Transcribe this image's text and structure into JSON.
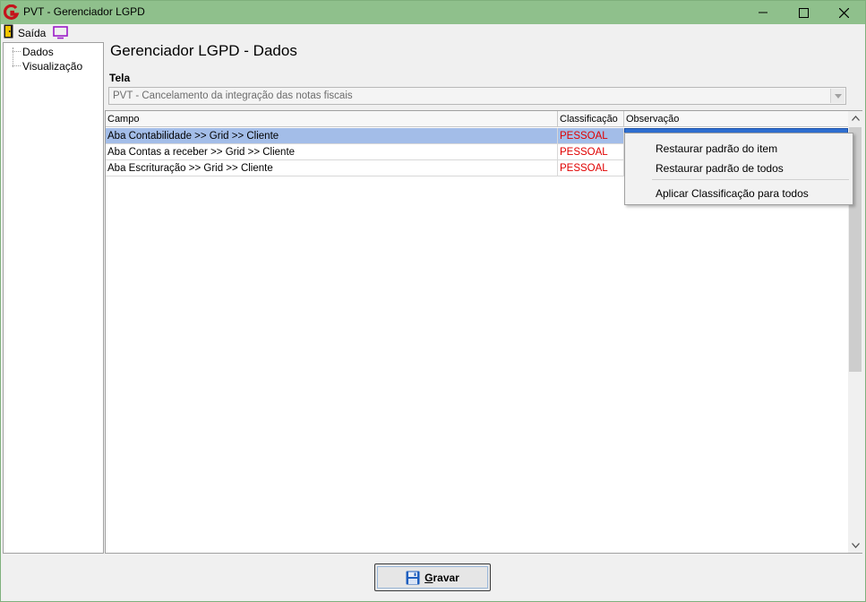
{
  "window": {
    "title": "PVT - Gerenciador LGPD"
  },
  "menu": {
    "exit_label": "Saída"
  },
  "tree": {
    "items": [
      "Dados",
      "Visualização"
    ]
  },
  "main": {
    "page_title": "Gerenciador LGPD - Dados",
    "tela_label": "Tela",
    "tela_value": "PVT - Cancelamento da integração das notas fiscais"
  },
  "grid": {
    "headers": {
      "campo": "Campo",
      "classificacao": "Classificação",
      "observacao": "Observação"
    },
    "rows": [
      {
        "campo": "Aba Contabilidade >> Grid >> Cliente",
        "classificacao": "PESSOAL",
        "observacao": ""
      },
      {
        "campo": "Aba Contas a receber >> Grid >> Cliente",
        "classificacao": "PESSOAL",
        "observacao": ""
      },
      {
        "campo": "Aba Escrituração >> Grid >> Cliente",
        "classificacao": "PESSOAL",
        "observacao": ""
      }
    ],
    "selected_row": 0
  },
  "context_menu": {
    "items": [
      "Restaurar padrão do item",
      "Restaurar padrão de todos",
      "Aplicar Classificação para todos"
    ]
  },
  "footer": {
    "gravar_first": "G",
    "gravar_rest": "ravar"
  },
  "colors": {
    "titlebar": "#8fc08c",
    "selected_row": "#a3bde8",
    "classification_text": "#e00000",
    "focus_cell": "#2f6fd0"
  },
  "icons": {
    "app": "app-logo-icon",
    "exit": "exit-door-icon",
    "monitor": "monitor-icon",
    "save": "floppy-disk-icon"
  }
}
